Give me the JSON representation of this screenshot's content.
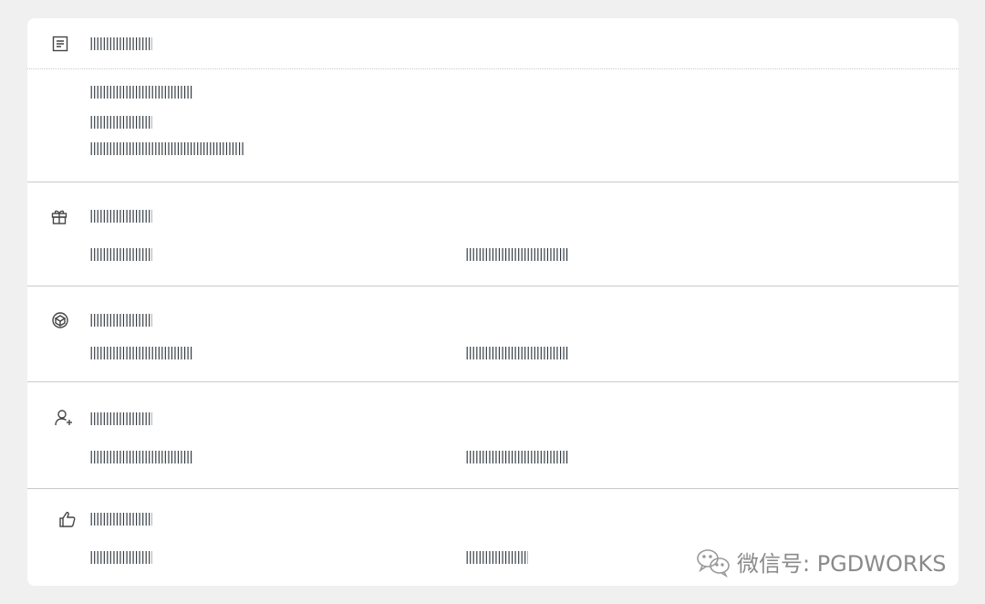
{
  "sections": [
    {
      "icon": "document-icon",
      "title": "||||||||||||||||||||",
      "lines": [
        "|||||||||||||||||||||||||||||||||",
        "||||||||||||||||||||",
        "|||||||||||||||||||||||||||||||||||||||||||||||||"
      ]
    },
    {
      "icon": "gift-icon",
      "title": "||||||||||||||||||||",
      "left": "||||||||||||||||||||",
      "right": "|||||||||||||||||||||||||||||||||"
    },
    {
      "icon": "cube-icon",
      "title": "||||||||||||||||||||",
      "left": "|||||||||||||||||||||||||||||||||",
      "right": "|||||||||||||||||||||||||||||||||"
    },
    {
      "icon": "add-user-icon",
      "title": "||||||||||||||||||||",
      "left": "|||||||||||||||||||||||||||||||||",
      "right": "|||||||||||||||||||||||||||||||||"
    },
    {
      "icon": "thumbs-up-icon",
      "title": "||||||||||||||||||||",
      "left": "||||||||||||||||||||",
      "right": "||||||||||||||||||||"
    }
  ],
  "watermark": {
    "icon": "wechat-logo",
    "text": "微信号: PGDWORKS"
  }
}
